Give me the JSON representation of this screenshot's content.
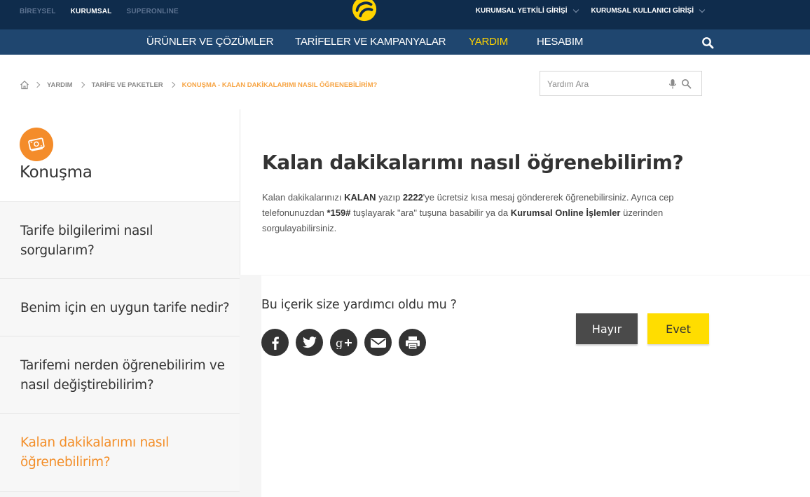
{
  "colors": {
    "topbar_bg": "#0f2c4c",
    "navbar_bg": "#1f466f",
    "accent_yellow": "#ffd400",
    "accent_orange": "#f38f2a",
    "share_bg": "#333333"
  },
  "topbar": {
    "segments": [
      "BİREYSEL",
      "KURUMSAL",
      "SUPERONLINE"
    ],
    "active_segment": "KURUMSAL",
    "logo_icon": "turkcell-logo-icon",
    "auth": {
      "yetkili": "KURUMSAL YETKİLİ GİRİŞİ",
      "kullanici": "KURUMSAL KULLANICI GİRİŞİ"
    }
  },
  "nav": {
    "items": [
      "ÜRÜNLER VE ÇÖZÜMLER",
      "TARİFELER VE KAMPANYALAR",
      "YARDIM",
      "HESABIM"
    ],
    "active": "YARDIM",
    "search_icon": "search-icon"
  },
  "breadcrumb": {
    "home_icon": "home-icon",
    "items": [
      "YARDIM",
      "TARİFE VE PAKETLER"
    ],
    "current": "KONUŞMA - KALAN DAKİKALARIMI NASIL ÖĞRENEBİLİRİM?"
  },
  "help_search": {
    "placeholder": "Yardım Ara",
    "mic_icon": "microphone-icon",
    "search_icon": "search-icon"
  },
  "sidebar": {
    "category_icon": "money-bill-icon",
    "category": "Konuşma",
    "items": [
      {
        "label": "Tarife bilgilerimi nasıl sorgularım?"
      },
      {
        "label": "Benim için en uygun tarife nedir?"
      },
      {
        "label": "Tarifemi nerden öğrenebilirim ve nasıl değiştirebilirim?"
      },
      {
        "label": "Kalan dakikalarımı nasıl öğrenebilirim?"
      }
    ],
    "active_index": 3
  },
  "content": {
    "title": "Kalan dakikalarımı nasıl öğrenebilirim?",
    "answer": {
      "p1": "Kalan dakikalarınızı ",
      "b1": "KALAN",
      "p2": " yazıp ",
      "b2": "2222",
      "p3": "'ye ücretsiz kısa mesaj göndererek öğrenebilirsiniz. Ayrıca cep telefonunuzdan ",
      "b3": "*159#",
      "p4": " tuşlayarak \"ara\" tuşuna basabilir ya da ",
      "b4": "Kurumsal Online İşlemler",
      "p5": " üzerinden sorgulayabilirsiniz."
    }
  },
  "feedback": {
    "question": "Bu içerik size yardımcı oldu mu ?",
    "share_icons": [
      "facebook-icon",
      "twitter-icon",
      "google-plus-icon",
      "email-icon",
      "print-icon"
    ],
    "no_label": "Hayır",
    "yes_label": "Evet"
  }
}
